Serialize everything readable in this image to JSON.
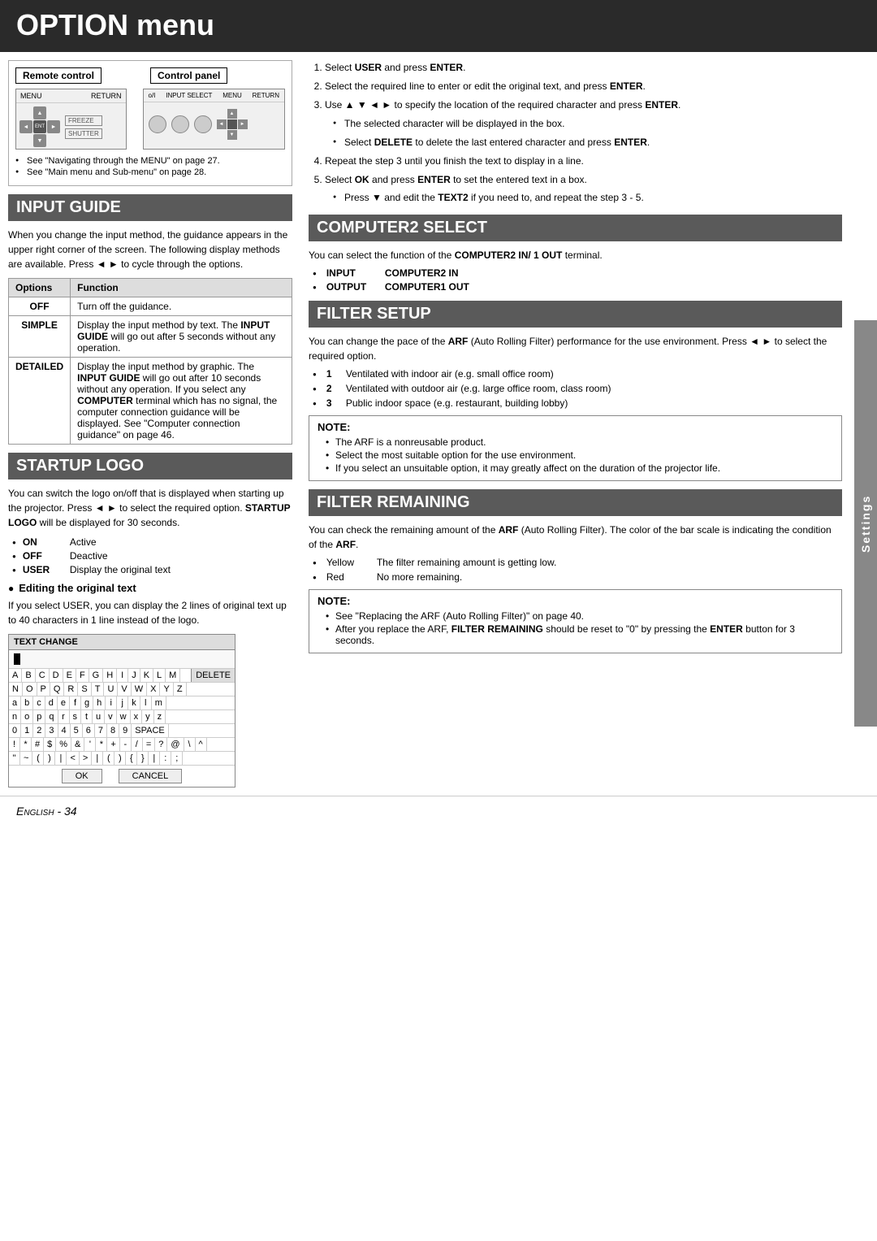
{
  "header": {
    "title": "OPTION menu"
  },
  "remote_control": {
    "label1": "Remote control",
    "label2": "Control panel",
    "notes": [
      "See \"Navigating through the MENU\" on page 27.",
      "See \"Main menu and Sub-menu\" on page 28."
    ]
  },
  "input_guide": {
    "section_title": "INPUT GUIDE",
    "description": "When you change the input method, the guidance appears in the upper right corner of the screen. The following display methods are available. Press ◄ ► to cycle through the options.",
    "table": {
      "col1": "Options",
      "col2": "Function",
      "rows": [
        {
          "option": "OFF",
          "function": "Turn off the guidance."
        },
        {
          "option": "SIMPLE",
          "function": "Display the input method by text. The INPUT GUIDE will go out after 5 seconds without any operation."
        },
        {
          "option": "DETAILED",
          "function": "Display the input method by graphic. The INPUT GUIDE will go out after 10 seconds without any operation. If you select any COMPUTER terminal which has no signal, the computer connection guidance will be displayed. See \"Computer connection guidance\" on page 46."
        }
      ]
    }
  },
  "startup_logo": {
    "section_title": "STARTUP LOGO",
    "description": "You can switch the logo on/off that is displayed when starting up the projector. Press ◄ ► to select the required option. STARTUP LOGO will be displayed for 30 seconds.",
    "options": [
      {
        "key": "ON",
        "value": "Active"
      },
      {
        "key": "OFF",
        "value": "Deactive"
      },
      {
        "key": "USER",
        "value": "Display the original text"
      }
    ],
    "edit_header": "Editing the original text",
    "edit_description": "If you select USER, you can display the 2 lines of original text up to 40 characters in 1 line instead of the logo.",
    "text_change_dialog": {
      "title": "TEXT CHANGE",
      "keyboard_rows": [
        {
          "keys": [
            "A",
            "B",
            "C",
            "D",
            "E",
            "F",
            "G",
            "H",
            "I",
            "J",
            "K",
            "L",
            "M"
          ],
          "delete_btn": "DELETE"
        },
        {
          "keys": [
            "N",
            "O",
            "P",
            "Q",
            "R",
            "S",
            "T",
            "U",
            "V",
            "W",
            "X",
            "Y",
            "Z"
          ],
          "delete_btn": ""
        },
        {
          "keys": [
            "a",
            "b",
            "c",
            "d",
            "e",
            "f",
            "g",
            "h",
            "i",
            "j",
            "k",
            "l",
            "m"
          ],
          "delete_btn": ""
        },
        {
          "keys": [
            "n",
            "o",
            "p",
            "q",
            "r",
            "s",
            "t",
            "u",
            "v",
            "w",
            "x",
            "y",
            "z"
          ],
          "delete_btn": ""
        },
        {
          "keys": [
            "0",
            "1",
            "2",
            "3",
            "4",
            "5",
            "6",
            "7",
            "8",
            "9",
            "SPACE"
          ],
          "delete_btn": ""
        },
        {
          "keys": [
            "!",
            "*",
            "#",
            "$",
            "%",
            "&",
            "'",
            "*",
            "+",
            "-",
            "/",
            "=",
            "?",
            "@",
            "\\",
            "^"
          ],
          "delete_btn": ""
        },
        {
          "keys": [
            "\"",
            "~",
            "(",
            ")",
            "|",
            "<",
            ">",
            "|",
            "(",
            ")",
            "{",
            "}",
            "|",
            "|",
            ":",
            ";"
          ],
          "delete_btn": ""
        }
      ],
      "ok_label": "OK",
      "cancel_label": "CANCEL"
    }
  },
  "right_column": {
    "steps": [
      "Select USER and press ENTER.",
      "Select the required line to enter or edit the original text, and press ENTER.",
      "Use ▲ ▼ ◄ ► to specify the location of the required character and press ENTER.",
      "Repeat the step 3 until you finish the text to display in a line.",
      "Select OK and press ENTER to set the entered text in a box."
    ],
    "step3_bullets": [
      "The selected character will be displayed in the box.",
      "Select DELETE to delete the last entered character and press ENTER."
    ],
    "step5_bullets": [
      "Press ▼ and edit the TEXT2 if you need to, and repeat the step 3 - 5."
    ]
  },
  "computer2_select": {
    "section_title": "COMPUTER2 SELECT",
    "description": "You can select the function of the COMPUTER2 IN/ 1 OUT terminal.",
    "options": [
      {
        "key": "INPUT",
        "value": "COMPUTER2 IN"
      },
      {
        "key": "OUTPUT",
        "value": "COMPUTER1 OUT"
      }
    ]
  },
  "filter_setup": {
    "section_title": "FILTER SETUP",
    "description": "You can change the pace of the ARF (Auto Rolling Filter) performance for the use environment. Press ◄ ► to select the required option.",
    "options": [
      {
        "num": "1",
        "description": "Ventilated with indoor air (e.g. small office room)"
      },
      {
        "num": "2",
        "description": "Ventilated with outdoor air (e.g. large office room, class room)"
      },
      {
        "num": "3",
        "description": "Public indoor space (e.g. restaurant, building lobby)"
      }
    ],
    "note": {
      "title": "NOTE:",
      "items": [
        "The ARF is a nonreusable product.",
        "Select the most suitable option for the use environment.",
        "If you select an unsuitable option, it may greatly affect on the duration of the projector life."
      ]
    }
  },
  "filter_remaining": {
    "section_title": "FILTER REMAINING",
    "description": "You can check the remaining amount of the ARF (Auto Rolling Filter). The color of the bar scale is indicating the condition of the ARF.",
    "options": [
      {
        "color": "Yellow",
        "description": "The filter remaining amount is getting low."
      },
      {
        "color": "Red",
        "description": "No more remaining."
      }
    ],
    "note": {
      "title": "NOTE:",
      "items": [
        "See \"Replacing the ARF (Auto Rolling Filter)\" on page 40.",
        "After you replace the ARF, FILTER REMAINING should be reset to \"0\" by pressing the ENTER button for 3 seconds."
      ]
    }
  },
  "footer": {
    "text": "English - 34"
  },
  "side_label": "Settings"
}
